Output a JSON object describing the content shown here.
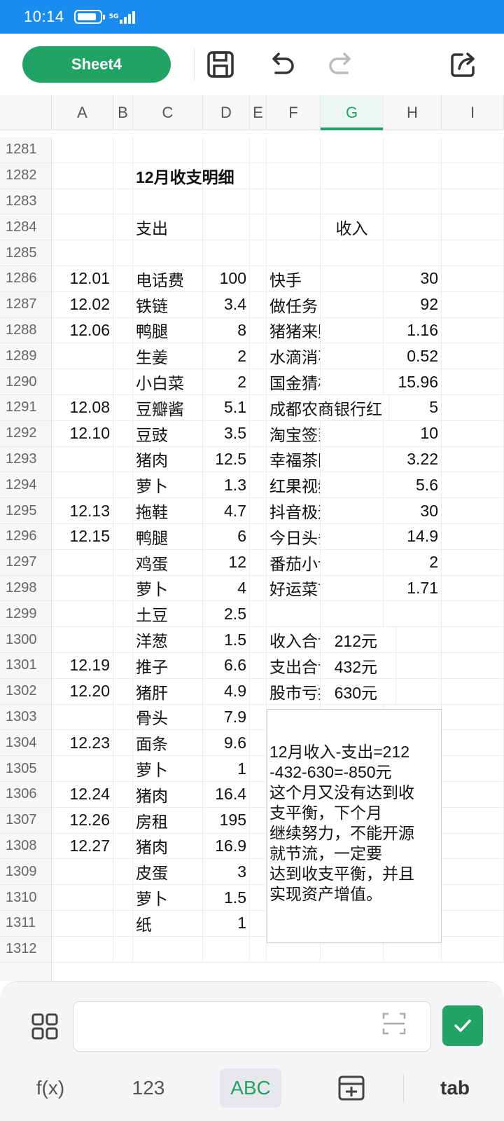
{
  "status_bar": {
    "time": "10:14",
    "network": "5G"
  },
  "toolbar": {
    "sheet_name": "Sheet4",
    "icons": [
      "save-icon",
      "undo-icon",
      "redo-icon",
      "share-icon"
    ]
  },
  "columns": [
    "A",
    "B",
    "C",
    "D",
    "E",
    "F",
    "G",
    "H",
    "I"
  ],
  "selected_column": "G",
  "rows": [
    {
      "num": "1281"
    },
    {
      "num": "1282",
      "C": "12月收支明细"
    },
    {
      "num": "1283"
    },
    {
      "num": "1284",
      "C": "支出",
      "G": "收入"
    },
    {
      "num": "1285"
    },
    {
      "num": "1286",
      "A": "12.01",
      "C": "电话费",
      "D": "100",
      "F": "快手",
      "H": "30"
    },
    {
      "num": "1287",
      "A": "12.02",
      "C": "铁链",
      "D": "3.4",
      "F": "做任务",
      "H": "92"
    },
    {
      "num": "1288",
      "A": "12.06",
      "C": "鸭腿",
      "D": "8",
      "F": "猪猪来财",
      "H": "1.16"
    },
    {
      "num": "1289",
      "C": "生姜",
      "D": "2",
      "F": "水滴消不停",
      "H": "0.52"
    },
    {
      "num": "1290",
      "C": "小白菜",
      "D": "2",
      "F": "国金猜板块",
      "H": "15.96"
    },
    {
      "num": "1291",
      "A": "12.08",
      "C": "豆瓣酱",
      "D": "5.1",
      "F": "成都农商银行红",
      "H": "5"
    },
    {
      "num": "1292",
      "A": "12.10",
      "C": "豆豉",
      "D": "3.5",
      "F": "淘宝签到",
      "H": "10"
    },
    {
      "num": "1293",
      "C": "猪肉",
      "D": "12.5",
      "F": "幸福茶园",
      "H": "3.22"
    },
    {
      "num": "1294",
      "C": "萝卜",
      "D": "1.3",
      "F": "红果视频",
      "H": "5.6"
    },
    {
      "num": "1295",
      "A": "12.13",
      "C": "拖鞋",
      "D": "4.7",
      "F": "抖音极速版",
      "H": "30"
    },
    {
      "num": "1296",
      "A": "12.15",
      "C": "鸭腿",
      "D": "6",
      "F": "今日头条",
      "H": "14.9"
    },
    {
      "num": "1297",
      "C": "鸡蛋",
      "D": "12",
      "F": "番茄小说",
      "H": "2"
    },
    {
      "num": "1298",
      "C": "萝卜",
      "D": "4",
      "F": "好运菜市场",
      "H": "1.71"
    },
    {
      "num": "1299",
      "C": "土豆",
      "D": "2.5"
    },
    {
      "num": "1300",
      "C": "洋葱",
      "D": "1.5",
      "F": "收入合计",
      "G": "212元"
    },
    {
      "num": "1301",
      "A": "12.19",
      "C": "推子",
      "D": "6.6",
      "F": "支出合计",
      "G": "432元"
    },
    {
      "num": "1302",
      "A": "12.20",
      "C": "猪肝",
      "D": "4.9",
      "F": "股市亏损",
      "G": "630元"
    },
    {
      "num": "1303",
      "C": "骨头",
      "D": "7.9"
    },
    {
      "num": "1304",
      "A": "12.23",
      "C": "面条",
      "D": "9.6"
    },
    {
      "num": "1305",
      "C": "萝卜",
      "D": "1"
    },
    {
      "num": "1306",
      "A": "12.24",
      "C": "猪肉",
      "D": "16.4"
    },
    {
      "num": "1307",
      "A": "12.26",
      "C": "房租",
      "D": "195"
    },
    {
      "num": "1308",
      "A": "12.27",
      "C": "猪肉",
      "D": "16.9"
    },
    {
      "num": "1309",
      "C": "皮蛋",
      "D": "3"
    },
    {
      "num": "1310",
      "C": "萝卜",
      "D": "1.5"
    },
    {
      "num": "1311",
      "C": "纸",
      "D": "1"
    },
    {
      "num": "1312"
    }
  ],
  "note": [
    "12月收入-支出=212",
    "-432-630=-850元",
    "这个月又没有达到收",
    "支平衡，下个月",
    "继续努力，不能开源",
    "就节流，一定要",
    "达到收支平衡，并且",
    "实现资产增值。"
  ],
  "input_bar": {
    "value": "",
    "accent": "#21a366"
  },
  "keyboard_tabs": [
    {
      "label": "f(x)",
      "active": false
    },
    {
      "label": "123",
      "active": false
    },
    {
      "label": "ABC",
      "active": true
    },
    {
      "label": "",
      "icon": "table-icon",
      "active": false
    },
    {
      "label": "tab",
      "active": false
    }
  ]
}
